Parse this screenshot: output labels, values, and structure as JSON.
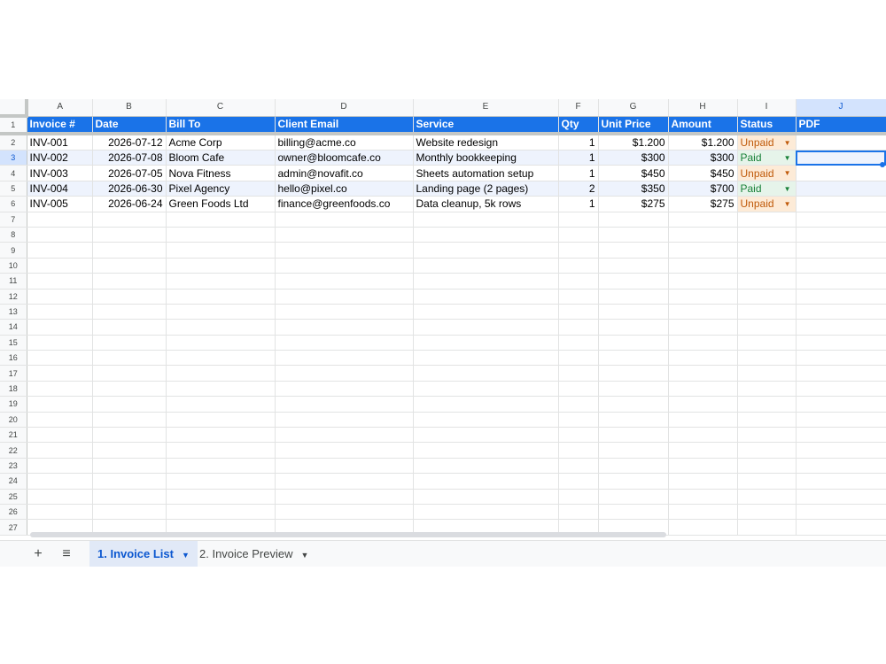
{
  "columns": [
    "A",
    "B",
    "C",
    "D",
    "E",
    "F",
    "G",
    "H",
    "I",
    "J"
  ],
  "header_row": [
    "Invoice #",
    "Date",
    "Bill To",
    "Client Email",
    "Service",
    "Qty",
    "Unit Price",
    "Amount",
    "Status",
    "PDF"
  ],
  "rows": [
    [
      "INV-001",
      "2026-07-12",
      "Acme Corp",
      "billing@acme.co",
      "Website redesign",
      "1",
      "$1.200",
      "$1.200",
      "Unpaid",
      ""
    ],
    [
      "INV-002",
      "2026-07-08",
      "Bloom Cafe",
      "owner@bloomcafe.co",
      "Monthly bookkeeping",
      "1",
      "$300",
      "$300",
      "Paid",
      ""
    ],
    [
      "INV-003",
      "2026-07-05",
      "Nova Fitness",
      "admin@novafit.co",
      "Sheets automation setup",
      "1",
      "$450",
      "$450",
      "Unpaid",
      ""
    ],
    [
      "INV-004",
      "2026-06-30",
      "Pixel Agency",
      "hello@pixel.co",
      "Landing page (2 pages)",
      "2",
      "$350",
      "$700",
      "Paid",
      ""
    ],
    [
      "INV-005",
      "2026-06-24",
      "Green Foods Ltd",
      "finance@greenfoods.co",
      "Data cleanup, 5k rows",
      "1",
      "$275",
      "$275",
      "Unpaid",
      ""
    ]
  ],
  "row_count": 27,
  "selected_cell": "J3",
  "status_colors": {
    "Unpaid": "#c05a0a",
    "Paid": "#188038"
  },
  "header_color": "#1a73e8",
  "sheet_tabs": [
    {
      "label": "1. Invoice List",
      "active": true
    },
    {
      "label": "2. Invoice Preview",
      "active": false
    }
  ],
  "icons": {
    "add_sheet": "plus-icon",
    "all_sheets": "menu-icon",
    "tab_menu": "caret-down-icon",
    "dropdown": "dropdown-arrow-icon"
  }
}
